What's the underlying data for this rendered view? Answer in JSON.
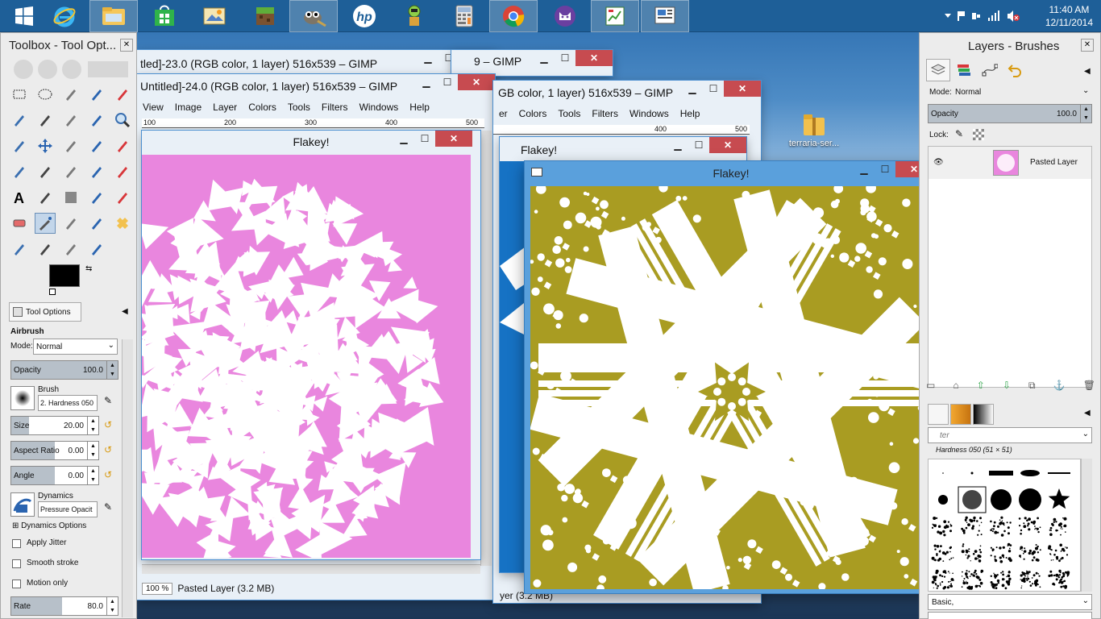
{
  "taskbar": {
    "apps": [
      {
        "name": "start"
      },
      {
        "name": "internet-explorer"
      },
      {
        "name": "file-explorer"
      },
      {
        "name": "store"
      },
      {
        "name": "image-app"
      },
      {
        "name": "minecraft"
      },
      {
        "name": "gimp"
      },
      {
        "name": "hp"
      },
      {
        "name": "game-app"
      },
      {
        "name": "calculator"
      },
      {
        "name": "chrome"
      },
      {
        "name": "cat-app"
      },
      {
        "name": "chart-app"
      },
      {
        "name": "presentation-app"
      }
    ],
    "time": "11:40 AM",
    "date": "12/11/2014"
  },
  "desktop": {
    "folder_label": "terraria-ser..."
  },
  "toolbox": {
    "title": "Toolbox - Tool Opt...",
    "tab_label": "Tool Options",
    "tool_name": "Airbrush",
    "mode_label": "Mode:",
    "mode_value": "Normal",
    "opacity_label": "Opacity",
    "opacity_value": "100.0",
    "brush_label": "Brush",
    "brush_value": "2. Hardness 050",
    "size_label": "Size",
    "size_value": "20.00",
    "aspect_label": "Aspect Ratio",
    "aspect_value": "0.00",
    "angle_label": "Angle",
    "angle_value": "0.00",
    "dynamics_label": "Dynamics",
    "dynamics_value": "Pressure Opacit",
    "dynamics_options": "Dynamics Options",
    "apply_jitter": "Apply Jitter",
    "smooth_stroke": "Smooth stroke",
    "motion_only": "Motion only",
    "rate_label": "Rate",
    "rate_value": "80.0",
    "fg_color": "#000000",
    "bg_color": "#ffffff"
  },
  "gimp_back": {
    "title1": "tled]-23.0 (RGB color, 1 layer) 516x539 – GIMP",
    "title1_right": "9 – GIMP",
    "title2": "Untitled]-24.0 (RGB color, 1 layer) 516x539 – GIMP",
    "title3": "GB color, 1 layer) 516x539 – GIMP",
    "menu_left": [
      "View",
      "Image",
      "Layer",
      "Colors",
      "Tools",
      "Filters",
      "Windows",
      "Help"
    ],
    "menu_right": [
      "er",
      "Colors",
      "Tools",
      "Filters",
      "Windows",
      "Help"
    ],
    "ruler_left": [
      "100",
      "200",
      "300",
      "400",
      "500"
    ],
    "ruler_right": [
      "400",
      "500"
    ],
    "zoom": "100 %",
    "layer_status": "Pasted Layer (3.2 MB)",
    "status_right": "yer (3.2 MB)"
  },
  "flakey_pink": {
    "title": "Flakey!",
    "bg": "#e986de"
  },
  "flakey_blue": {
    "title": "Flakey!",
    "bg": "#1672c4"
  },
  "flakey_gold": {
    "title": "Flakey!",
    "bg": "#a99c22"
  },
  "layers": {
    "title": "Layers - Brushes",
    "mode_label": "Mode:",
    "mode_value": "Normal",
    "opacity_label": "Opacity",
    "opacity_value": "100.0",
    "lock_label": "Lock:",
    "layer_name": "Pasted Layer",
    "brush_filter_placeholder": "ter",
    "brush_name": "Hardness 050 (51 × 51)",
    "preset": "Basic,"
  }
}
